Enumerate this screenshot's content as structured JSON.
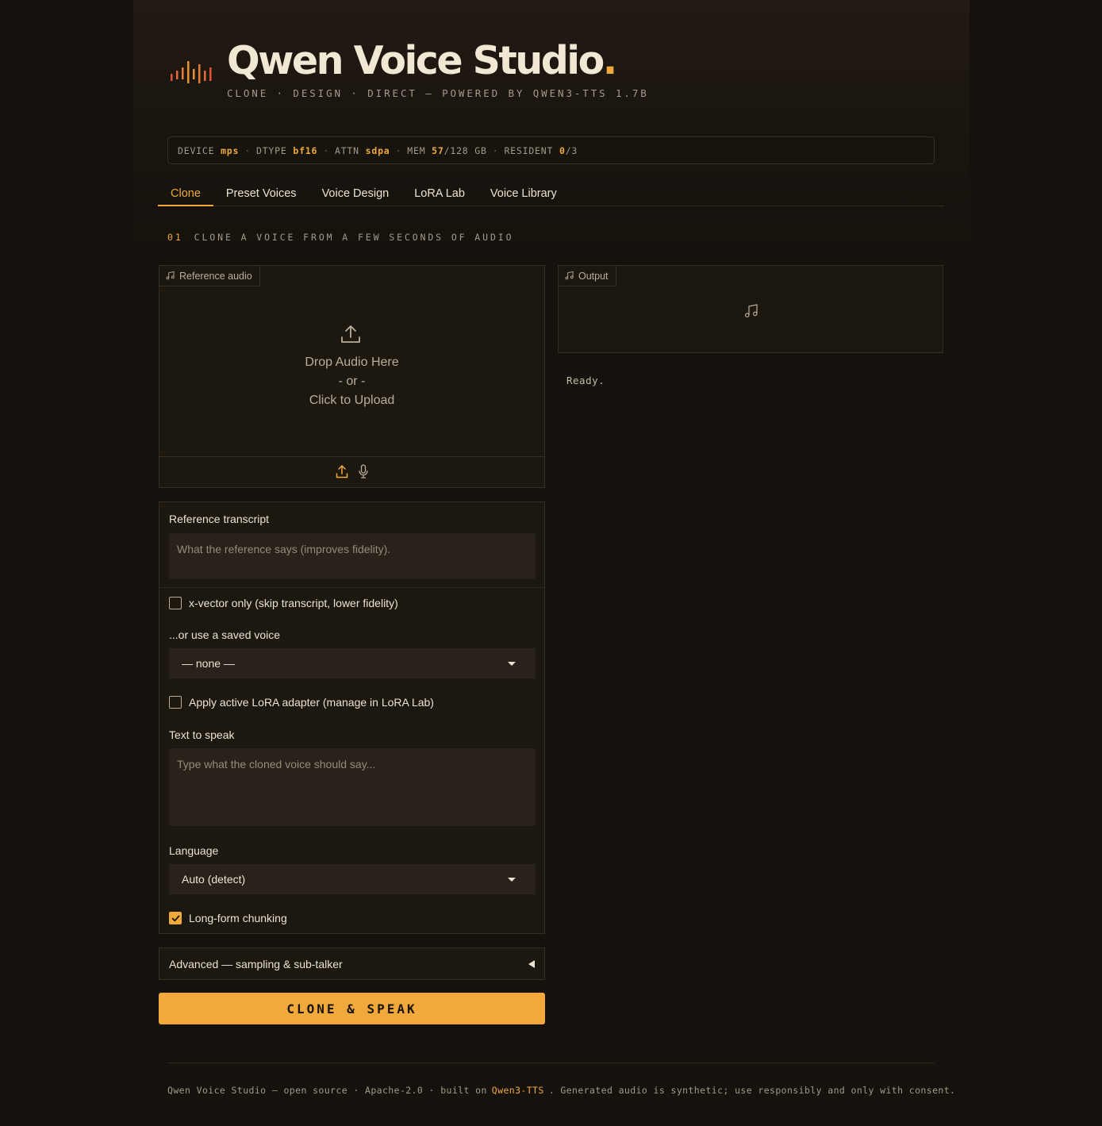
{
  "header": {
    "title": "Qwen Voice Studio",
    "title_dot": ".",
    "subtitle": "CLONE · DESIGN · DIRECT — POWERED BY QWEN3-TTS 1.7B"
  },
  "status": {
    "device_label": "DEVICE",
    "device": "mps",
    "dtype_label": "DTYPE",
    "dtype": "bf16",
    "attn_label": "ATTN",
    "attn": "sdpa",
    "mem_label": "MEM",
    "mem_used": "57",
    "mem_total": "/128 GB",
    "resident_label": "RESIDENT",
    "resident": "0",
    "resident_total": "/3",
    "sep": "·"
  },
  "tabs": [
    "Clone",
    "Preset Voices",
    "Voice Design",
    "LoRA Lab",
    "Voice Library"
  ],
  "active_tab": "Clone",
  "section": {
    "number": "01",
    "title": "CLONE A VOICE FROM A FEW SECONDS OF AUDIO"
  },
  "reference_audio": {
    "label": "Reference audio",
    "drop_line1": "Drop Audio Here",
    "drop_line2": "- or -",
    "drop_line3": "Click to Upload"
  },
  "output": {
    "label": "Output",
    "status": "Ready."
  },
  "form": {
    "transcript_label": "Reference transcript",
    "transcript_placeholder": "What the reference says (improves fidelity).",
    "xvector_label": "x-vector only (skip transcript, lower fidelity)",
    "xvector_checked": false,
    "saved_voice_label": "...or use a saved voice",
    "saved_voice_value": "— none —",
    "lora_label": "Apply active LoRA adapter (manage in LoRA Lab)",
    "lora_checked": false,
    "text_label": "Text to speak",
    "text_placeholder": "Type what the cloned voice should say...",
    "language_label": "Language",
    "language_value": "Auto (detect)",
    "longform_label": "Long-form chunking",
    "longform_checked": true
  },
  "advanced": {
    "label": "Advanced — sampling & sub-talker"
  },
  "primary_button": "CLONE & SPEAK",
  "footer": {
    "text1": "Qwen Voice Studio — open source · Apache-2.0 · built on",
    "link": "Qwen3-TTS",
    "text2": ". Generated audio is synthetic; use responsibly and only with consent."
  },
  "colors": {
    "accent": "#f0a93a",
    "background": "#15110c",
    "logo_red": "#e0553a"
  },
  "icons": [
    "waveform-logo-icon",
    "music-note-icon",
    "upload-icon",
    "microphone-icon",
    "check-icon",
    "chevron-down-icon",
    "triangle-left-icon"
  ]
}
